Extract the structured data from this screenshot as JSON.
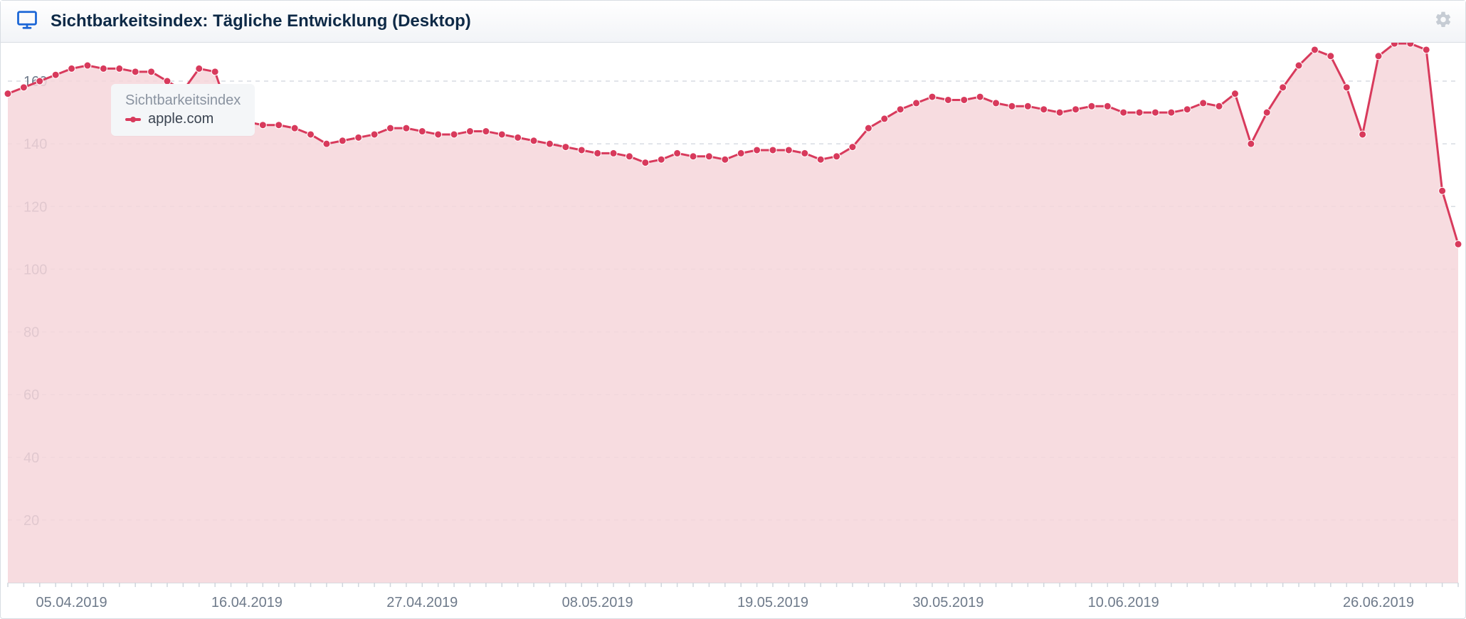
{
  "header": {
    "title": "Sichtbarkeitsindex: Tägliche Entwicklung (Desktop)"
  },
  "legend": {
    "title": "Sichtbarkeitsindex",
    "series_label": "apple.com"
  },
  "chart_data": {
    "type": "area",
    "title": "Sichtbarkeitsindex: Tägliche Entwicklung (Desktop)",
    "xlabel": "",
    "ylabel": "",
    "ylim": [
      0,
      170
    ],
    "y_ticks": [
      20,
      40,
      60,
      80,
      100,
      120,
      140,
      160
    ],
    "x_tick_labels": [
      "05.04.2019",
      "16.04.2019",
      "27.04.2019",
      "08.05.2019",
      "19.05.2019",
      "30.05.2019",
      "10.06.2019",
      "26.06.2019"
    ],
    "x": [
      "01.04.2019",
      "02.04.2019",
      "03.04.2019",
      "04.04.2019",
      "05.04.2019",
      "06.04.2019",
      "07.04.2019",
      "08.04.2019",
      "09.04.2019",
      "10.04.2019",
      "11.04.2019",
      "12.04.2019",
      "13.04.2019",
      "14.04.2019",
      "15.04.2019",
      "16.04.2019",
      "17.04.2019",
      "18.04.2019",
      "19.04.2019",
      "20.04.2019",
      "21.04.2019",
      "22.04.2019",
      "23.04.2019",
      "24.04.2019",
      "25.04.2019",
      "26.04.2019",
      "27.04.2019",
      "28.04.2019",
      "29.04.2019",
      "30.04.2019",
      "01.05.2019",
      "02.05.2019",
      "03.05.2019",
      "04.05.2019",
      "05.05.2019",
      "06.05.2019",
      "07.05.2019",
      "08.05.2019",
      "09.05.2019",
      "10.05.2019",
      "11.05.2019",
      "12.05.2019",
      "13.05.2019",
      "14.05.2019",
      "15.05.2019",
      "16.05.2019",
      "17.05.2019",
      "18.05.2019",
      "19.05.2019",
      "20.05.2019",
      "21.05.2019",
      "22.05.2019",
      "23.05.2019",
      "24.05.2019",
      "25.05.2019",
      "26.05.2019",
      "27.05.2019",
      "28.05.2019",
      "29.05.2019",
      "30.05.2019",
      "31.05.2019",
      "01.06.2019",
      "02.06.2019",
      "03.06.2019",
      "04.06.2019",
      "05.06.2019",
      "06.06.2019",
      "07.06.2019",
      "08.06.2019",
      "09.06.2019",
      "10.06.2019",
      "11.06.2019",
      "12.06.2019",
      "13.06.2019",
      "14.06.2019",
      "15.06.2019",
      "16.06.2019",
      "17.06.2019",
      "18.06.2019",
      "19.06.2019",
      "20.06.2019",
      "21.06.2019",
      "22.06.2019",
      "23.06.2019",
      "24.06.2019",
      "25.06.2019",
      "26.06.2019",
      "27.06.2019",
      "28.06.2019",
      "29.06.2019",
      "30.06.2019",
      "01.07.2019"
    ],
    "series": [
      {
        "name": "apple.com",
        "color": "#d83a5c",
        "values": [
          156,
          158,
          160,
          162,
          164,
          165,
          164,
          164,
          163,
          163,
          160,
          157,
          164,
          163,
          148,
          147,
          146,
          146,
          145,
          143,
          140,
          141,
          142,
          143,
          145,
          145,
          144,
          143,
          143,
          144,
          144,
          143,
          142,
          141,
          140,
          139,
          138,
          137,
          137,
          136,
          134,
          135,
          137,
          136,
          136,
          135,
          137,
          138,
          138,
          138,
          137,
          135,
          136,
          139,
          145,
          148,
          151,
          153,
          155,
          154,
          154,
          155,
          153,
          152,
          152,
          151,
          150,
          151,
          152,
          152,
          150,
          150,
          150,
          150,
          151,
          153,
          152,
          156,
          140,
          150,
          158,
          165,
          170,
          168,
          158,
          143,
          168,
          172,
          172,
          170,
          125,
          108
        ]
      }
    ]
  }
}
